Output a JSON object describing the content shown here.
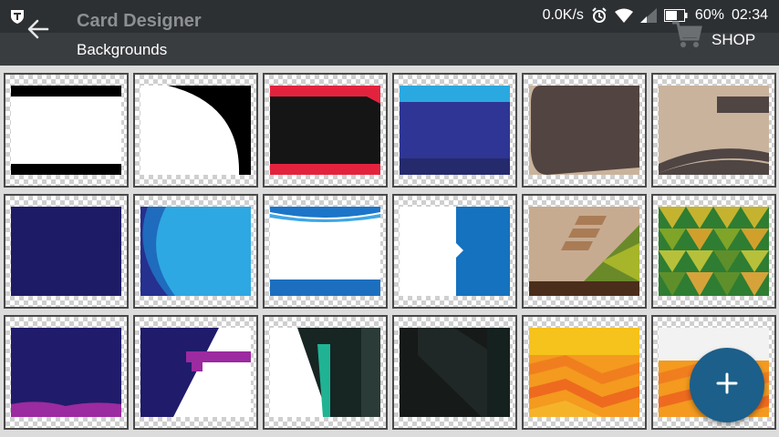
{
  "status_bar": {
    "speed": "0.0K/s",
    "battery": "60%",
    "time": "02:34",
    "icons": [
      "app-logo-icon",
      "alarm-icon",
      "wifi-icon",
      "signal-icon",
      "battery-icon"
    ]
  },
  "toolbar": {
    "title": "Card Designer",
    "subtitle": "Backgrounds",
    "shop_label": "SHOP",
    "back_icon": "arrow-left-icon",
    "shop_icon": "shopping-cart-icon"
  },
  "fab": {
    "label": "+",
    "color": "#1b5f8a"
  },
  "colors": {
    "statusbar": "#2d3033",
    "toolbar": "#3a3d40",
    "grid_bg": "#dcdcdc",
    "tile_border": "#4a4a4a"
  },
  "backgrounds": [
    {
      "id": "bg-01",
      "style": "white-black-bars"
    },
    {
      "id": "bg-02",
      "style": "white-curve-black"
    },
    {
      "id": "bg-03",
      "style": "black-red-bars"
    },
    {
      "id": "bg-04",
      "style": "blue-bands"
    },
    {
      "id": "bg-05",
      "style": "brown-wave"
    },
    {
      "id": "bg-06",
      "style": "tan-swoosh"
    },
    {
      "id": "bg-07",
      "style": "navy-solid"
    },
    {
      "id": "bg-08",
      "style": "blue-circles"
    },
    {
      "id": "bg-09",
      "style": "white-blue-wave"
    },
    {
      "id": "bg-10",
      "style": "white-blue-arrow"
    },
    {
      "id": "bg-11",
      "style": "tan-triangles"
    },
    {
      "id": "bg-12",
      "style": "green-triangles"
    },
    {
      "id": "bg-13",
      "style": "navy-purple-wave"
    },
    {
      "id": "bg-14",
      "style": "navy-white-diagonal"
    },
    {
      "id": "bg-15",
      "style": "white-teal-stripes"
    },
    {
      "id": "bg-16",
      "style": "black-diagonal"
    },
    {
      "id": "bg-17",
      "style": "orange-diamonds"
    },
    {
      "id": "bg-18",
      "style": "orange-white"
    }
  ]
}
